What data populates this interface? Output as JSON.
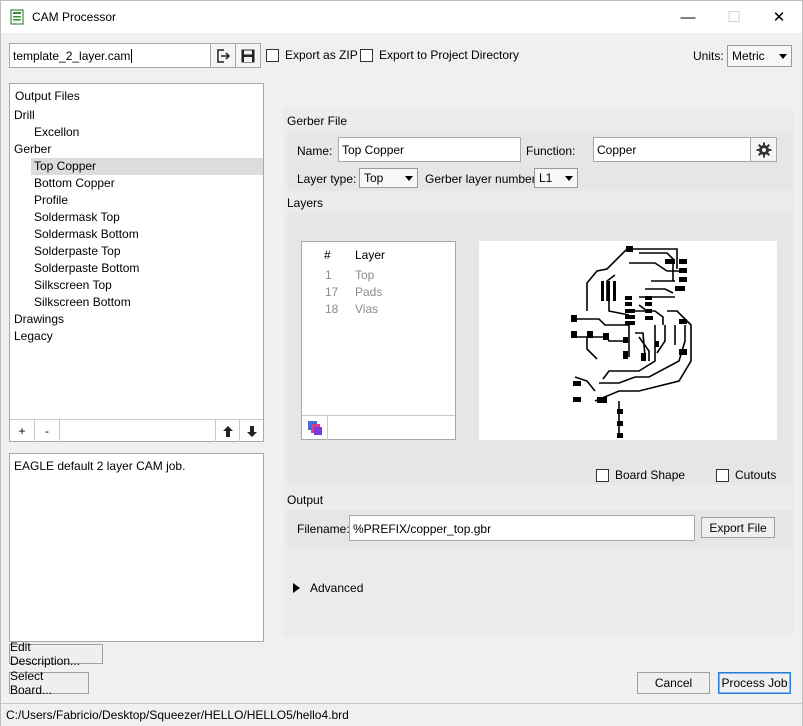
{
  "window": {
    "title": "CAM Processor"
  },
  "job": {
    "file_name": "template_2_layer.cam",
    "export_zip_label": "Export as ZIP",
    "export_project_label": "Export to Project Directory",
    "units_label": "Units:",
    "units_value": "Metric"
  },
  "output_files": {
    "header": "Output Files",
    "items": [
      {
        "label": "Drill",
        "level": 0
      },
      {
        "label": "Excellon",
        "level": 1
      },
      {
        "label": "Gerber",
        "level": 0
      },
      {
        "label": "Top Copper",
        "level": 1,
        "selected": true
      },
      {
        "label": "Bottom Copper",
        "level": 1
      },
      {
        "label": "Profile",
        "level": 1
      },
      {
        "label": "Soldermask Top",
        "level": 1
      },
      {
        "label": "Soldermask Bottom",
        "level": 1
      },
      {
        "label": "Solderpaste Top",
        "level": 1
      },
      {
        "label": "Solderpaste Bottom",
        "level": 1
      },
      {
        "label": "Silkscreen Top",
        "level": 1
      },
      {
        "label": "Silkscreen Bottom",
        "level": 1
      },
      {
        "label": "Drawings",
        "level": 0
      },
      {
        "label": "Legacy",
        "level": 0
      }
    ],
    "add_label": "+",
    "remove_label": "-"
  },
  "description": {
    "text": "EAGLE default 2 layer CAM job.",
    "edit_button": "Edit Description...",
    "select_board_button": "Select Board..."
  },
  "gerber": {
    "section_title": "Gerber File",
    "name_label": "Name:",
    "name_value": "Top Copper",
    "function_label": "Function:",
    "function_value": "Copper",
    "layer_type_label": "Layer type:",
    "layer_type_value": "Top",
    "gerber_layer_label": "Gerber layer number:",
    "gerber_layer_value": "L1"
  },
  "layers": {
    "section_title": "Layers",
    "col_num": "#",
    "col_layer": "Layer",
    "rows": [
      {
        "num": "1",
        "name": "Top"
      },
      {
        "num": "17",
        "name": "Pads"
      },
      {
        "num": "18",
        "name": "Vias"
      }
    ],
    "board_shape_label": "Board Shape",
    "cutouts_label": "Cutouts"
  },
  "output": {
    "section_title": "Output",
    "filename_label": "Filename:",
    "filename_value": "%PREFIX/copper_top.gbr",
    "export_file_button": "Export File"
  },
  "advanced": {
    "label": "Advanced"
  },
  "actions": {
    "cancel": "Cancel",
    "process": "Process Job"
  },
  "status": {
    "path": "C:/Users/Fabricio/Desktop/Squeezer/HELLO/HELLO5/hello4.brd"
  }
}
